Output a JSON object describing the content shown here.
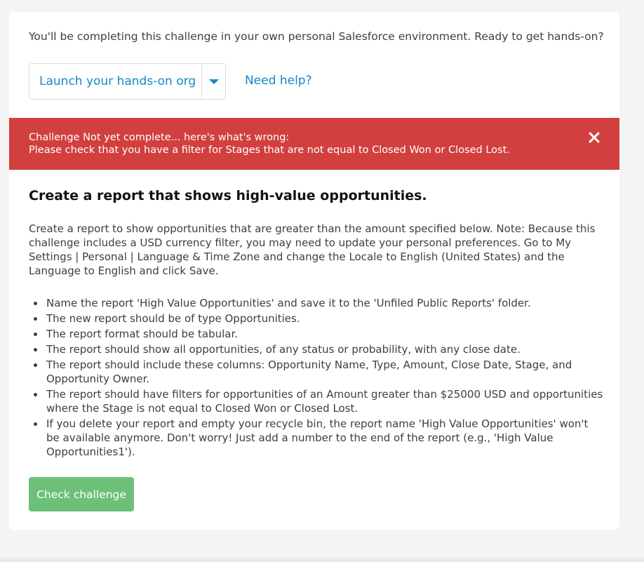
{
  "intro": {
    "text": "You'll be completing this challenge in your own personal Salesforce environment. Ready to get hands-on?"
  },
  "launch": {
    "label": "Launch your hands-on org",
    "caret_icon": "chevron-down-icon"
  },
  "help": {
    "label": "Need help?"
  },
  "error": {
    "line1": "Challenge Not yet complete... here's what's wrong:",
    "line2": "Please check that you have a filter for Stages that are not equal to Closed Won or Closed Lost.",
    "close_icon": "close-icon",
    "color": "#d23f3f"
  },
  "challenge": {
    "title": "Create a report that shows high-value opportunities.",
    "description": "Create a report to show opportunities that are greater than the amount specified below. Note: Because this challenge includes a USD currency filter, you may need to update your personal preferences. Go to My Settings | Personal | Language & Time Zone and change the Locale to English (United States) and the Language to English and click Save.",
    "requirements": [
      "Name the report 'High Value Opportunities' and save it to the 'Unfiled Public Reports' folder.",
      "The new report should be of type Opportunities.",
      "The report format should be tabular.",
      "The report should show all opportunities, of any status or probability, with any close date.",
      "The report should include these columns: Opportunity Name, Type, Amount, Close Date, Stage, and Opportunity Owner.",
      "The report should have filters for opportunities of an Amount greater than $25000 USD and opportunities where the Stage is not equal to Closed Won or Closed Lost.",
      "If you delete your report and empty your recycle bin, the report name 'High Value Opportunities' won't be available anymore. Don't worry! Just add a number to the end of the report (e.g., 'High Value Opportunities1')."
    ]
  },
  "check_button": {
    "label": "Check challenge",
    "color": "#6dc07a"
  },
  "colors": {
    "link": "#1589c8",
    "background": "#f4f4f4"
  }
}
